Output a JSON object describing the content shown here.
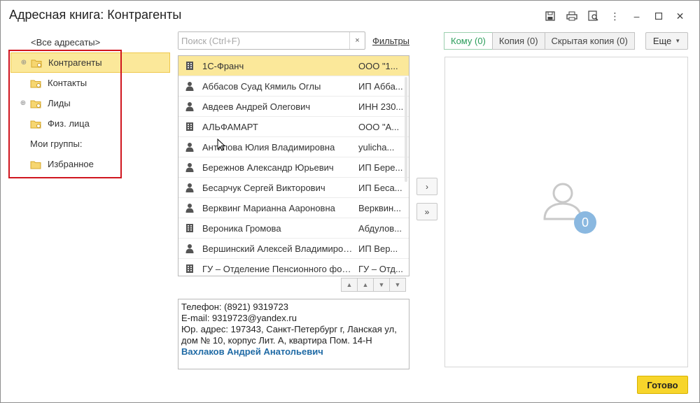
{
  "window": {
    "title": "Адресная книга: Контрагенты",
    "tools": [
      "save-icon",
      "print-icon",
      "preview-icon",
      "more-vertical-icon",
      "minimize-icon",
      "maximize-icon",
      "close-icon"
    ]
  },
  "tree": {
    "all_label": "<Все адресаты>",
    "items": [
      {
        "label": "Контрагенты",
        "expandable": true,
        "selected": true
      },
      {
        "label": "Контакты",
        "expandable": false
      },
      {
        "label": "Лиды",
        "expandable": true
      },
      {
        "label": "Физ. лица",
        "expandable": false
      }
    ],
    "groups_caption": "Мои группы:",
    "group_items": [
      {
        "label": "Избранное"
      }
    ]
  },
  "search": {
    "placeholder": "Поиск (Ctrl+F)",
    "value": "",
    "clear_label": "×"
  },
  "filters_label": "Фильтры",
  "contacts": [
    {
      "type": "org",
      "name": "1С-Франч",
      "extra": "ООО \"1...",
      "selected": true
    },
    {
      "type": "person",
      "name": "Аббасов Суад Кямиль Оглы",
      "extra": "ИП Абба..."
    },
    {
      "type": "person",
      "name": "Авдеев Андрей Олегович",
      "extra": "ИНН 230..."
    },
    {
      "type": "org",
      "name": "АЛЬФАМАРТ",
      "extra": "ООО \"А..."
    },
    {
      "type": "person",
      "name": "Антипова Юлия Владимировна",
      "extra": "yulicha..."
    },
    {
      "type": "person",
      "name": "Бережнов Александр Юрьевич",
      "extra": "ИП Бере..."
    },
    {
      "type": "person",
      "name": "Бесарчук Сергей Викторович",
      "extra": "ИП Беса..."
    },
    {
      "type": "person",
      "name": "Верквинг Марианна Аароновна",
      "extra": "Верквин..."
    },
    {
      "type": "org",
      "name": "Вероника Громова",
      "extra": "Абдулов..."
    },
    {
      "type": "person",
      "name": "Вершинский Алексей Владимирович",
      "extra": "ИП Вер..."
    },
    {
      "type": "org",
      "name": "ГУ – Отделение Пенсионного фонда",
      "extra": "ГУ – Отд..."
    }
  ],
  "details": {
    "line1": "Телефон: (8921) 9319723",
    "line2": "E-mail: 9319723@yandex.ru",
    "line3": "Юр. адрес: 197343, Санкт-Петербург г, Ланская ул,",
    "line4": "дом № 10, корпус Лит. А, квартира Пом. 14-Н",
    "person": "Вахлаков Андрей Анатольевич"
  },
  "move": {
    "one": "›",
    "all": "»"
  },
  "tabs": [
    {
      "label": "Кому (0)",
      "active": true
    },
    {
      "label": "Копия (0)",
      "active": false
    },
    {
      "label": "Скрытая копия (0)",
      "active": false
    }
  ],
  "more_label": "Еще",
  "recipients_count": "0",
  "done_label": "Готово",
  "colors": {
    "accent_green": "#2a9d5a",
    "selection": "#fbe89a",
    "primary_button": "#f7d52b",
    "highlight_frame": "#d0161f",
    "link_blue": "#1f6aa5"
  }
}
